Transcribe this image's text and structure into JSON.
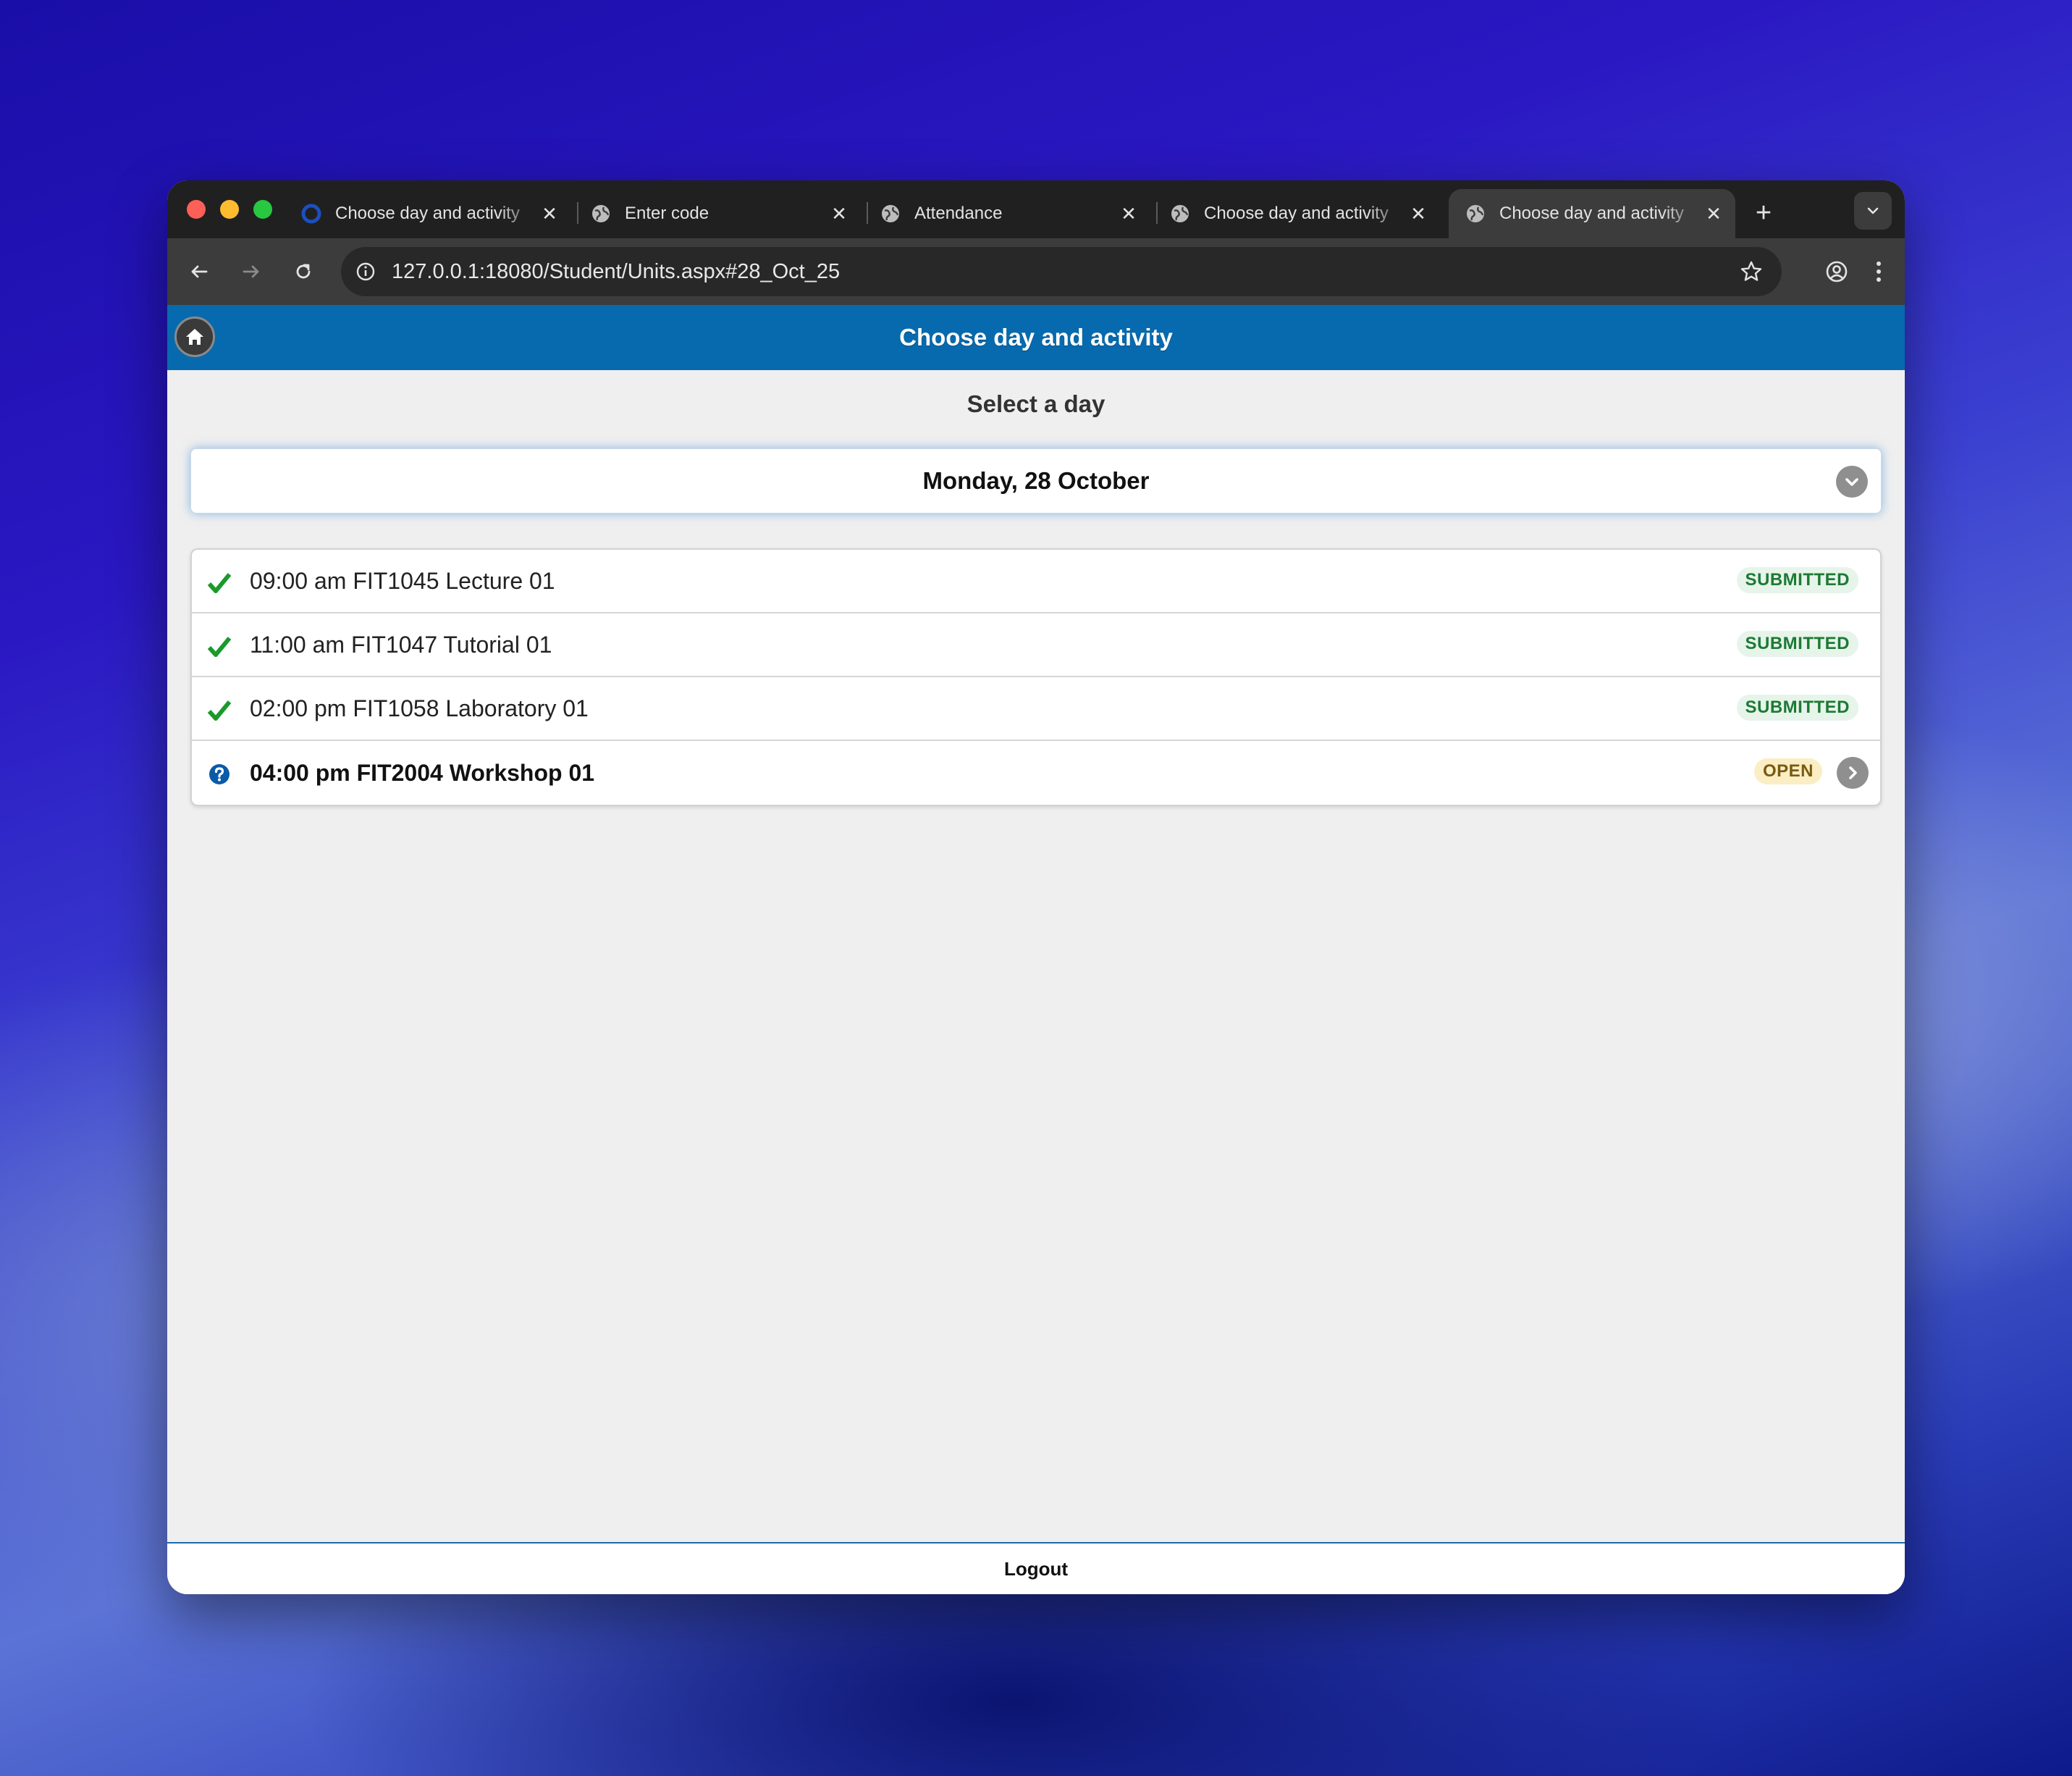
{
  "browser": {
    "tabs": [
      {
        "title": "Choose day and activity",
        "favicon": "app-favicon",
        "active": false
      },
      {
        "title": "Enter code",
        "favicon": "globe-icon",
        "active": false
      },
      {
        "title": "Attendance",
        "favicon": "globe-icon",
        "active": false
      },
      {
        "title": "Choose day and activity",
        "favicon": "globe-icon",
        "active": false
      },
      {
        "title": "Choose day and activity",
        "favicon": "globe-icon",
        "active": true
      }
    ],
    "url": "127.0.0.1:18080/Student/Units.aspx#28_Oct_25"
  },
  "page": {
    "header_title": "Choose day and activity",
    "subtitle": "Select a day",
    "selected_day": "Monday, 28 October",
    "activities": [
      {
        "time_and_name": "09:00 am FIT1045 Lecture 01",
        "status": "SUBMITTED",
        "icon": "checkmark-icon"
      },
      {
        "time_and_name": "11:00 am FIT1047 Tutorial 01",
        "status": "SUBMITTED",
        "icon": "checkmark-icon"
      },
      {
        "time_and_name": "02:00 pm FIT1058 Laboratory 01",
        "status": "SUBMITTED",
        "icon": "checkmark-icon"
      },
      {
        "time_and_name": "04:00 pm FIT2004 Workshop 01",
        "status": "OPEN",
        "icon": "question-icon"
      }
    ],
    "logout_label": "Logout"
  },
  "colors": {
    "header_blue": "#076aae",
    "submitted_green": "#1c7a34",
    "open_amber": "#7a5a10",
    "check_green": "#1a9a2a",
    "question_blue": "#0b5aa8"
  }
}
